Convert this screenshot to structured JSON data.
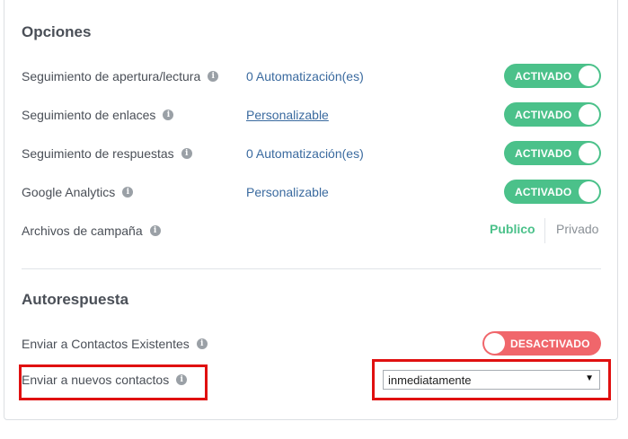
{
  "options": {
    "title": "Opciones",
    "rows": [
      {
        "label": "Seguimiento de apertura/lectura",
        "value": "0 Automatización(es)",
        "toggle": "ACTIVADO"
      },
      {
        "label": "Seguimiento de enlaces",
        "value": "Personalizable",
        "toggle": "ACTIVADO"
      },
      {
        "label": "Seguimiento de respuestas",
        "value": "0 Automatización(es)",
        "toggle": "ACTIVADO"
      },
      {
        "label": "Google Analytics",
        "value": "Personalizable",
        "toggle": "ACTIVADO"
      }
    ],
    "archive": {
      "label": "Archivos de campaña",
      "public": "Publico",
      "private": "Privado"
    }
  },
  "autoresponse": {
    "title": "Autorespuesta",
    "existing": {
      "label": "Enviar a Contactos Existentes",
      "toggle": "DESACTIVADO"
    },
    "new": {
      "label": "Enviar a nuevos contactos",
      "select_value": "inmediatamente"
    }
  },
  "colors": {
    "on": "#4bc18a",
    "off": "#f0666b",
    "link": "#3a6a9f",
    "highlight": "#e01010"
  },
  "icons": {
    "info": "info-icon",
    "dropdown": "dropdown-arrow-icon"
  }
}
